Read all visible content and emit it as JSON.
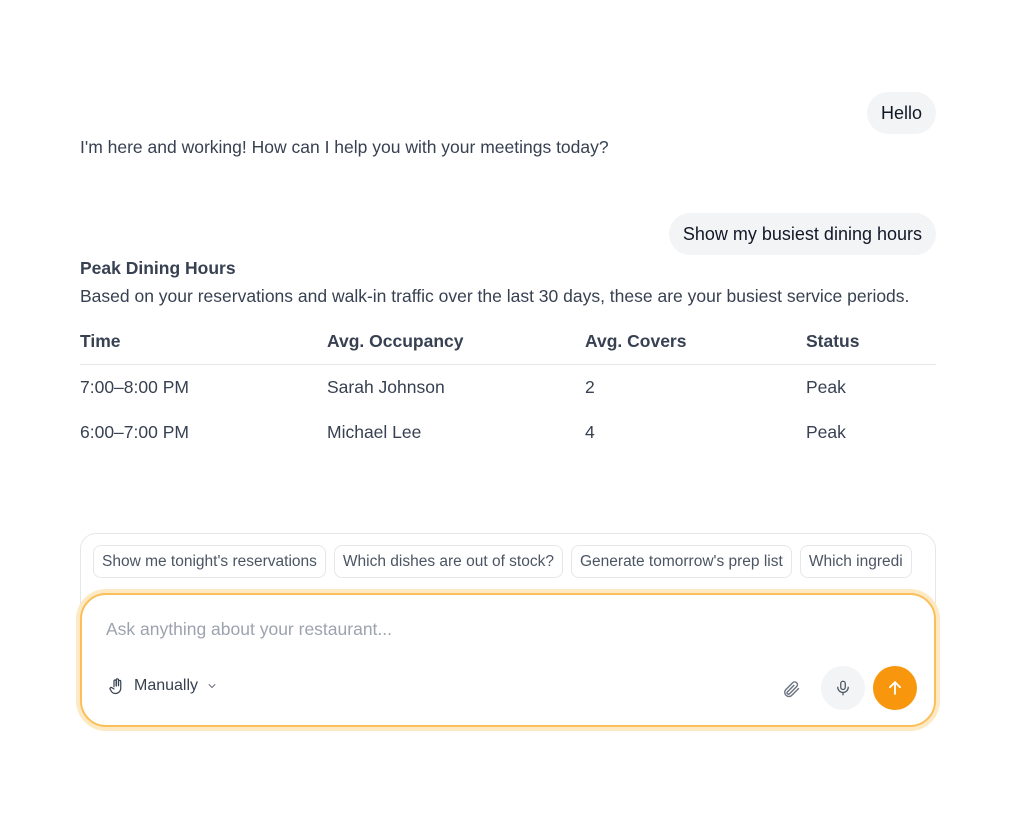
{
  "conversation": {
    "user_message_1": "Hello",
    "assistant_message_1": "I'm here and working! How can I help you with your meetings today?",
    "user_message_2": "Show my busiest dining hours",
    "answer": {
      "title": "Peak Dining Hours",
      "description": "Based on your reservations and walk-in traffic over the last 30 days, these are your busiest service periods.",
      "columns": [
        "Time",
        "Avg. Occupancy",
        "Avg. Covers",
        "Status"
      ],
      "rows": [
        [
          "7:00–8:00 PM",
          "Sarah Johnson",
          "2",
          "Peak"
        ],
        [
          "6:00–7:00 PM",
          "Michael Lee",
          "4",
          "Peak"
        ]
      ]
    }
  },
  "message_actions": [
    {
      "icon": "copy-icon"
    },
    {
      "icon": "thumbs-up-icon"
    },
    {
      "icon": "thumbs-down-icon"
    },
    {
      "icon": "refresh-icon"
    }
  ],
  "suggestions": [
    "Show me tonight's reservations",
    "Which dishes are out of stock?",
    "Generate tomorrow's prep list",
    "Which ingredi"
  ],
  "composer": {
    "placeholder": "Ask anything about your restaurant...",
    "mode_label": "Manually",
    "accent_color": "#f8960d",
    "focus_border_color": "#fbbf5a"
  }
}
